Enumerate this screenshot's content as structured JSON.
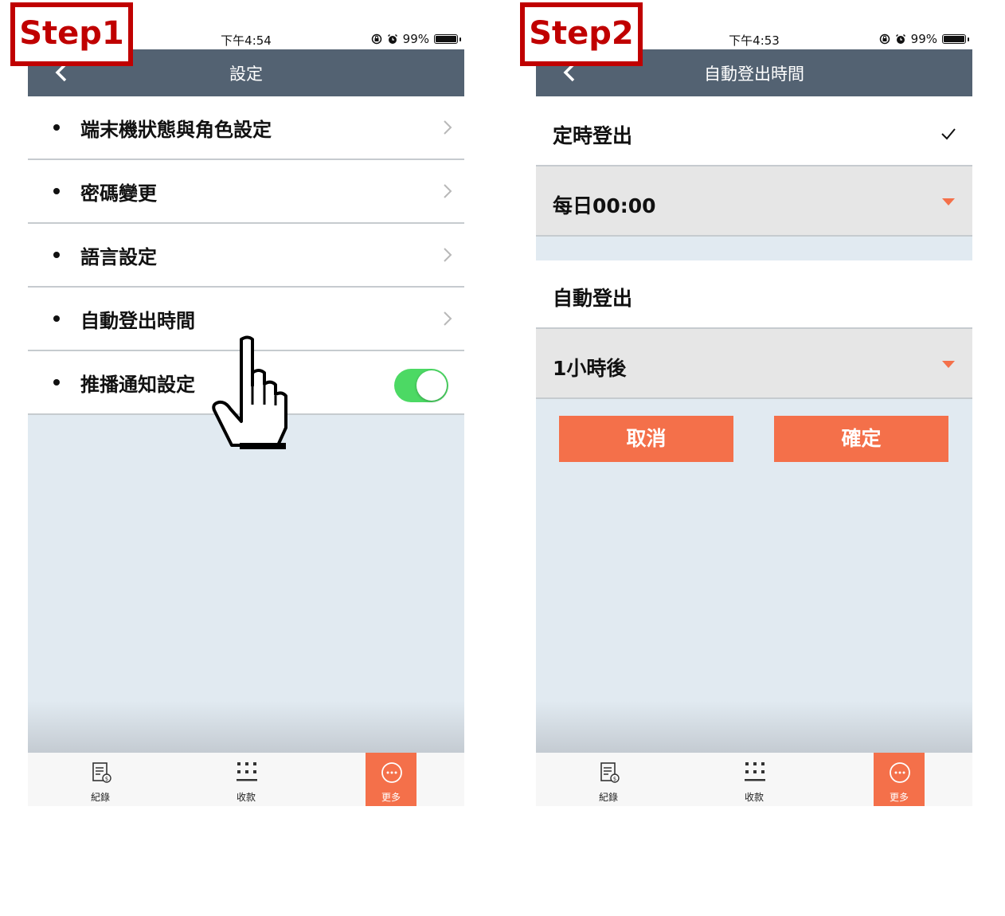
{
  "step1": {
    "badge": "Step1",
    "status": {
      "time": "下午4:54",
      "battery": "99%"
    },
    "nav_title": "設定",
    "items": [
      {
        "label": "端末機狀態與角色設定"
      },
      {
        "label": "密碼變更"
      },
      {
        "label": "語言設定"
      },
      {
        "label": "自動登出時間"
      },
      {
        "label": "推播通知設定",
        "toggle_on": true
      }
    ],
    "tabs": [
      {
        "label": "紀錄",
        "icon": "receipt-icon"
      },
      {
        "label": "收款",
        "icon": "keypad-icon"
      },
      {
        "label": "更多",
        "icon": "more-icon",
        "active": true
      }
    ]
  },
  "step2": {
    "badge": "Step2",
    "status": {
      "time": "下午4:53",
      "battery": "99%"
    },
    "nav_title": "自動登出時間",
    "scheduled_logout": {
      "label": "定時登出",
      "value": "每日00:00",
      "checked": true
    },
    "auto_logout": {
      "label": "自動登出",
      "value": "1小時後"
    },
    "cancel_label": "取消",
    "confirm_label": "確定",
    "tabs": [
      {
        "label": "紀錄",
        "icon": "receipt-icon"
      },
      {
        "label": "收款",
        "icon": "keypad-icon"
      },
      {
        "label": "更多",
        "icon": "more-icon",
        "active": true
      }
    ]
  },
  "colors": {
    "accent": "#f4704a",
    "navbar": "#536272",
    "badge": "#c00000",
    "toggle": "#4cd964",
    "background": "#e1eaf1"
  }
}
